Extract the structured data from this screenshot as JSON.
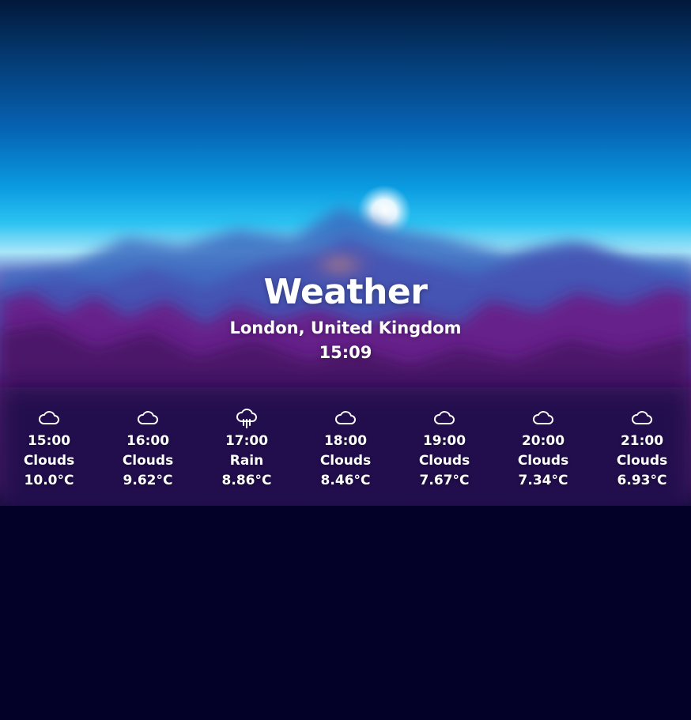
{
  "colors": {
    "sky_top": "#01183a",
    "sky_mid": "#0078c8",
    "sky_horizon": "#7fd8f6",
    "forest": "#5a1a7a",
    "ground": "#030128",
    "text": "#ffffff"
  },
  "header": {
    "title": "Weather",
    "location": "London, United Kingdom",
    "time": "15:09"
  },
  "forecast": [
    {
      "time": "15:00",
      "condition": "Clouds",
      "temp": "10.0°C",
      "icon": "cloud-icon"
    },
    {
      "time": "16:00",
      "condition": "Clouds",
      "temp": "9.62°C",
      "icon": "cloud-icon"
    },
    {
      "time": "17:00",
      "condition": "Rain",
      "temp": "8.86°C",
      "icon": "rain-cloud-icon"
    },
    {
      "time": "18:00",
      "condition": "Clouds",
      "temp": "8.46°C",
      "icon": "cloud-icon"
    },
    {
      "time": "19:00",
      "condition": "Clouds",
      "temp": "7.67°C",
      "icon": "cloud-icon"
    },
    {
      "time": "20:00",
      "condition": "Clouds",
      "temp": "7.34°C",
      "icon": "cloud-icon"
    },
    {
      "time": "21:00",
      "condition": "Clouds",
      "temp": "6.93°C",
      "icon": "cloud-icon"
    }
  ]
}
